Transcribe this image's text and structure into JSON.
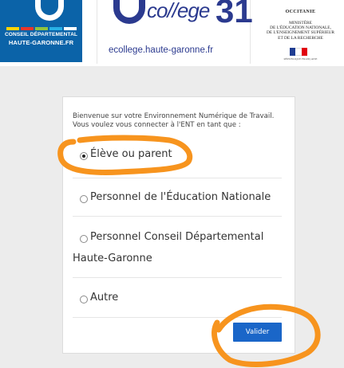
{
  "header": {
    "cd_logo": {
      "line1": "CONSEIL DÉPARTEMENTAL",
      "line2": "HAUTE-GARONNE.FR",
      "stripe_colors": [
        "#ffd400",
        "#e9362b",
        "#8fc43f",
        "#29b1e6",
        "#ffffff"
      ]
    },
    "ecollege": {
      "wordmark": "co//ege",
      "number": "31",
      "url": "ecollege.haute-garonne.fr"
    },
    "ministere": {
      "region": "OCCITANIE",
      "lines": [
        "MINISTÈRE",
        "DE L'ÉDUCATION NATIONALE,",
        "DE L'ENSEIGNEMENT SUPÉRIEUR",
        "ET DE LA RECHERCHE"
      ],
      "footer": "RÉPUBLIQUE FRANÇAISE"
    }
  },
  "login": {
    "intro": "Bienvenue sur votre Environnement Numérique de Travail. Vous voulez vous connecter à l'ENT en tant que :",
    "options": [
      {
        "label": "Élève ou parent",
        "selected": true
      },
      {
        "label": "Personnel de l'Éducation Nationale",
        "selected": false
      },
      {
        "label": "Personnel Conseil Départemental",
        "selected": false
      },
      {
        "label": "Autre",
        "selected": false
      }
    ],
    "option3_line2": "Haute-Garonne",
    "submit_label": "Valider"
  },
  "colors": {
    "accent": "#1a66c8",
    "annotation": "#f7941e",
    "brand_blue": "#0b63a8"
  }
}
